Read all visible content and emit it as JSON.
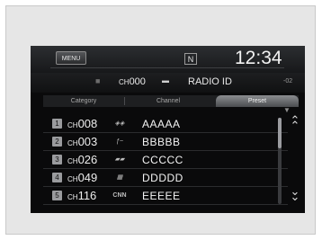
{
  "header": {
    "menu_label": "MENU",
    "nav_indicator": "N",
    "clock": "12:34"
  },
  "info": {
    "channel_prefix": "CH",
    "channel_number": "000",
    "radio_id_label": "RADIO ID",
    "channel_count": "-02"
  },
  "tabs": [
    {
      "label": "Category"
    },
    {
      "label": "Channel"
    },
    {
      "label": "Preset"
    }
  ],
  "active_tab": "Preset",
  "presets": [
    {
      "number": "1",
      "ch_prefix": "CH",
      "channel": "008",
      "name": "AAAAA",
      "logo": "icon"
    },
    {
      "number": "2",
      "ch_prefix": "CH",
      "channel": "003",
      "name": "BBBBB",
      "logo": "icon"
    },
    {
      "number": "3",
      "ch_prefix": "CH",
      "channel": "026",
      "name": "CCCCC",
      "logo": "icon"
    },
    {
      "number": "4",
      "ch_prefix": "CH",
      "channel": "049",
      "name": "DDDDD",
      "logo": "icon"
    },
    {
      "number": "5",
      "ch_prefix": "CH",
      "channel": "116",
      "name": "EEEEE",
      "logo": "CNN"
    }
  ],
  "icons": {
    "scroll_up": "double-chevron-up-icon",
    "scroll_down": "double-chevron-down-icon"
  }
}
